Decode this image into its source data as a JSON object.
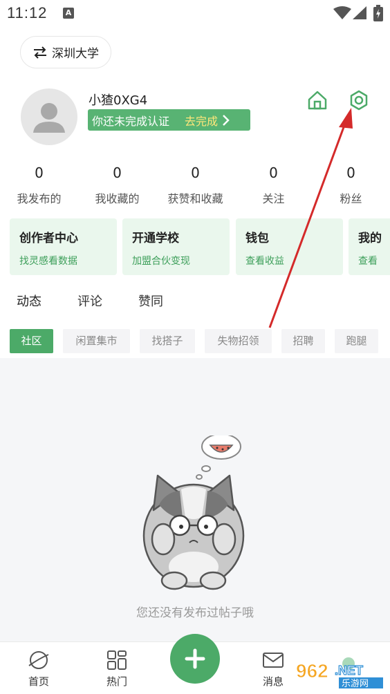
{
  "status_bar": {
    "time": "11:12",
    "notif_letter": "A"
  },
  "header": {
    "school_name": "深圳大学"
  },
  "profile": {
    "username": "小猹0XG4",
    "verify_text": "你还未完成认证",
    "verify_action": "去完成"
  },
  "stats": [
    {
      "value": "0",
      "label": "我发布的"
    },
    {
      "value": "0",
      "label": "我收藏的"
    },
    {
      "value": "0",
      "label": "获赞和收藏"
    },
    {
      "value": "0",
      "label": "关注"
    },
    {
      "value": "0",
      "label": "粉丝"
    }
  ],
  "cards": [
    {
      "title": "创作者中心",
      "subtitle": "找灵感看数据"
    },
    {
      "title": "开通学校",
      "subtitle": "加盟合伙变现"
    },
    {
      "title": "钱包",
      "subtitle": "查看收益"
    },
    {
      "title": "我的",
      "subtitle": "查看"
    }
  ],
  "tabs": [
    {
      "label": "动态",
      "active": true
    },
    {
      "label": "评论",
      "active": false
    },
    {
      "label": "赞同",
      "active": false
    }
  ],
  "chips": [
    {
      "label": "社区",
      "active": true
    },
    {
      "label": "闲置集市",
      "active": false
    },
    {
      "label": "找搭子",
      "active": false
    },
    {
      "label": "失物招领",
      "active": false
    },
    {
      "label": "招聘",
      "active": false
    },
    {
      "label": "跑腿",
      "active": false
    }
  ],
  "empty_state": {
    "message": "您还没有发布过帖子哦"
  },
  "bottom_nav": [
    {
      "label": "首页",
      "icon": "planet-icon"
    },
    {
      "label": "热门",
      "icon": "grid-icon"
    },
    {
      "label": "",
      "icon": "plus-icon"
    },
    {
      "label": "消息",
      "icon": "mail-icon"
    }
  ],
  "watermark": {
    "text": "962.NET",
    "subtext": "乐游网"
  },
  "colors": {
    "accent": "#4caa68",
    "card_bg": "#eaf7ed",
    "verify_bg": "#58b373",
    "verify_action": "#ffe77a",
    "arrow": "#d42a2a"
  }
}
